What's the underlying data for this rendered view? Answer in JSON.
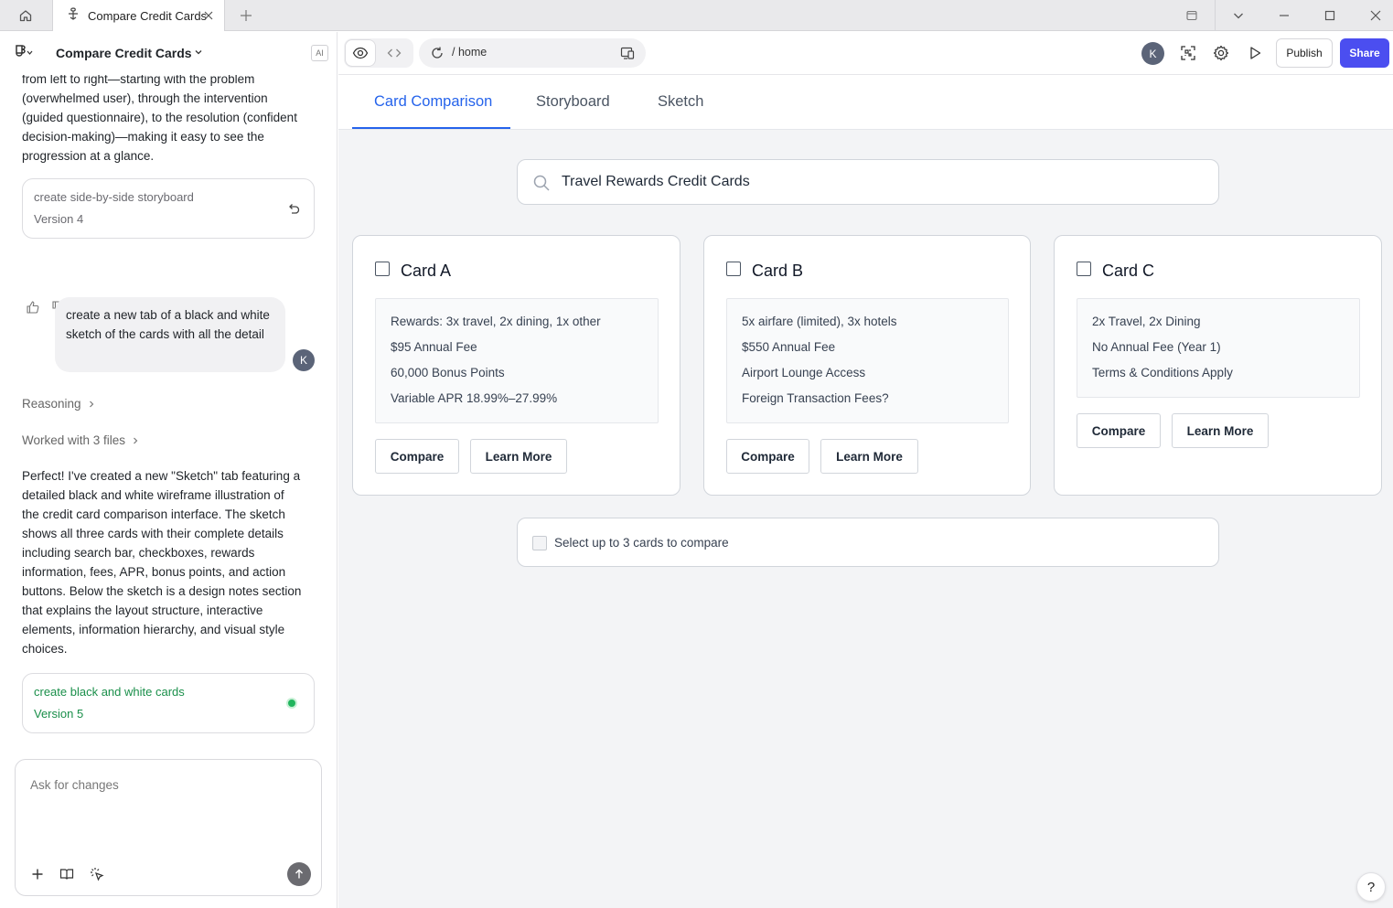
{
  "browser": {
    "tab_title": "Compare Credit Cards"
  },
  "left_panel": {
    "project_title": "Compare Credit Cards",
    "ai_badge": "AI",
    "partial_message": [
      "from left to right—starting with the problem",
      "(overwhelmed user), through the intervention",
      "(guided questionnaire), to the resolution (confident",
      "decision-making)—making it easy to see the",
      "progression at a glance."
    ],
    "version_4": {
      "title": "create side-by-side storyboard",
      "subtitle": "Version 4"
    },
    "user_message": "create a new tab of a black and white sketch of the cards with all the detail",
    "user_avatar": "K",
    "reasoning_label": "Reasoning",
    "files_label": "Worked with 3 files",
    "assistant_message": [
      "Perfect! I've created a new \"Sketch\" tab featuring a",
      "detailed black and white wireframe illustration of",
      "the credit card comparison interface. The sketch",
      "shows all three cards with their complete details",
      "including search bar, checkboxes, rewards",
      "information, fees, APR, bonus points, and action",
      "buttons. Below the sketch is a design notes section",
      "that explains the layout structure, interactive",
      "elements, information hierarchy, and visual style",
      "choices."
    ],
    "version_5": {
      "title": "create black and white cards",
      "subtitle": "Version 5"
    },
    "input_placeholder": "Ask for changes"
  },
  "toolbar": {
    "url_path": "/  home",
    "avatar": "K",
    "publish_label": "Publish",
    "share_label": "Share"
  },
  "preview": {
    "tabs": [
      {
        "label": "Card Comparison",
        "active": true
      },
      {
        "label": "Storyboard",
        "active": false
      },
      {
        "label": "Sketch",
        "active": false
      }
    ],
    "search_value": "Travel Rewards Credit Cards",
    "cards": [
      {
        "name": "Card A",
        "details": [
          "Rewards: 3x travel, 2x dining, 1x other",
          "$95 Annual Fee",
          "60,000 Bonus Points",
          "Variable APR 18.99%–27.99%"
        ],
        "compare_label": "Compare",
        "learn_label": "Learn More"
      },
      {
        "name": "Card B",
        "details": [
          "5x airfare (limited), 3x hotels",
          "$550 Annual Fee",
          "Airport Lounge Access",
          "Foreign Transaction Fees?"
        ],
        "compare_label": "Compare",
        "learn_label": "Learn More"
      },
      {
        "name": "Card C",
        "details": [
          "2x Travel, 2x Dining",
          "No Annual Fee (Year 1)",
          "Terms & Conditions Apply"
        ],
        "compare_label": "Compare",
        "learn_label": "Learn More"
      }
    ],
    "select_label": "Select up to 3 cards to compare",
    "help_label": "?"
  },
  "colors": {
    "accent_blue": "#2563eb",
    "share_purple": "#4b4ef0",
    "version_green": "#1a8f4a"
  }
}
